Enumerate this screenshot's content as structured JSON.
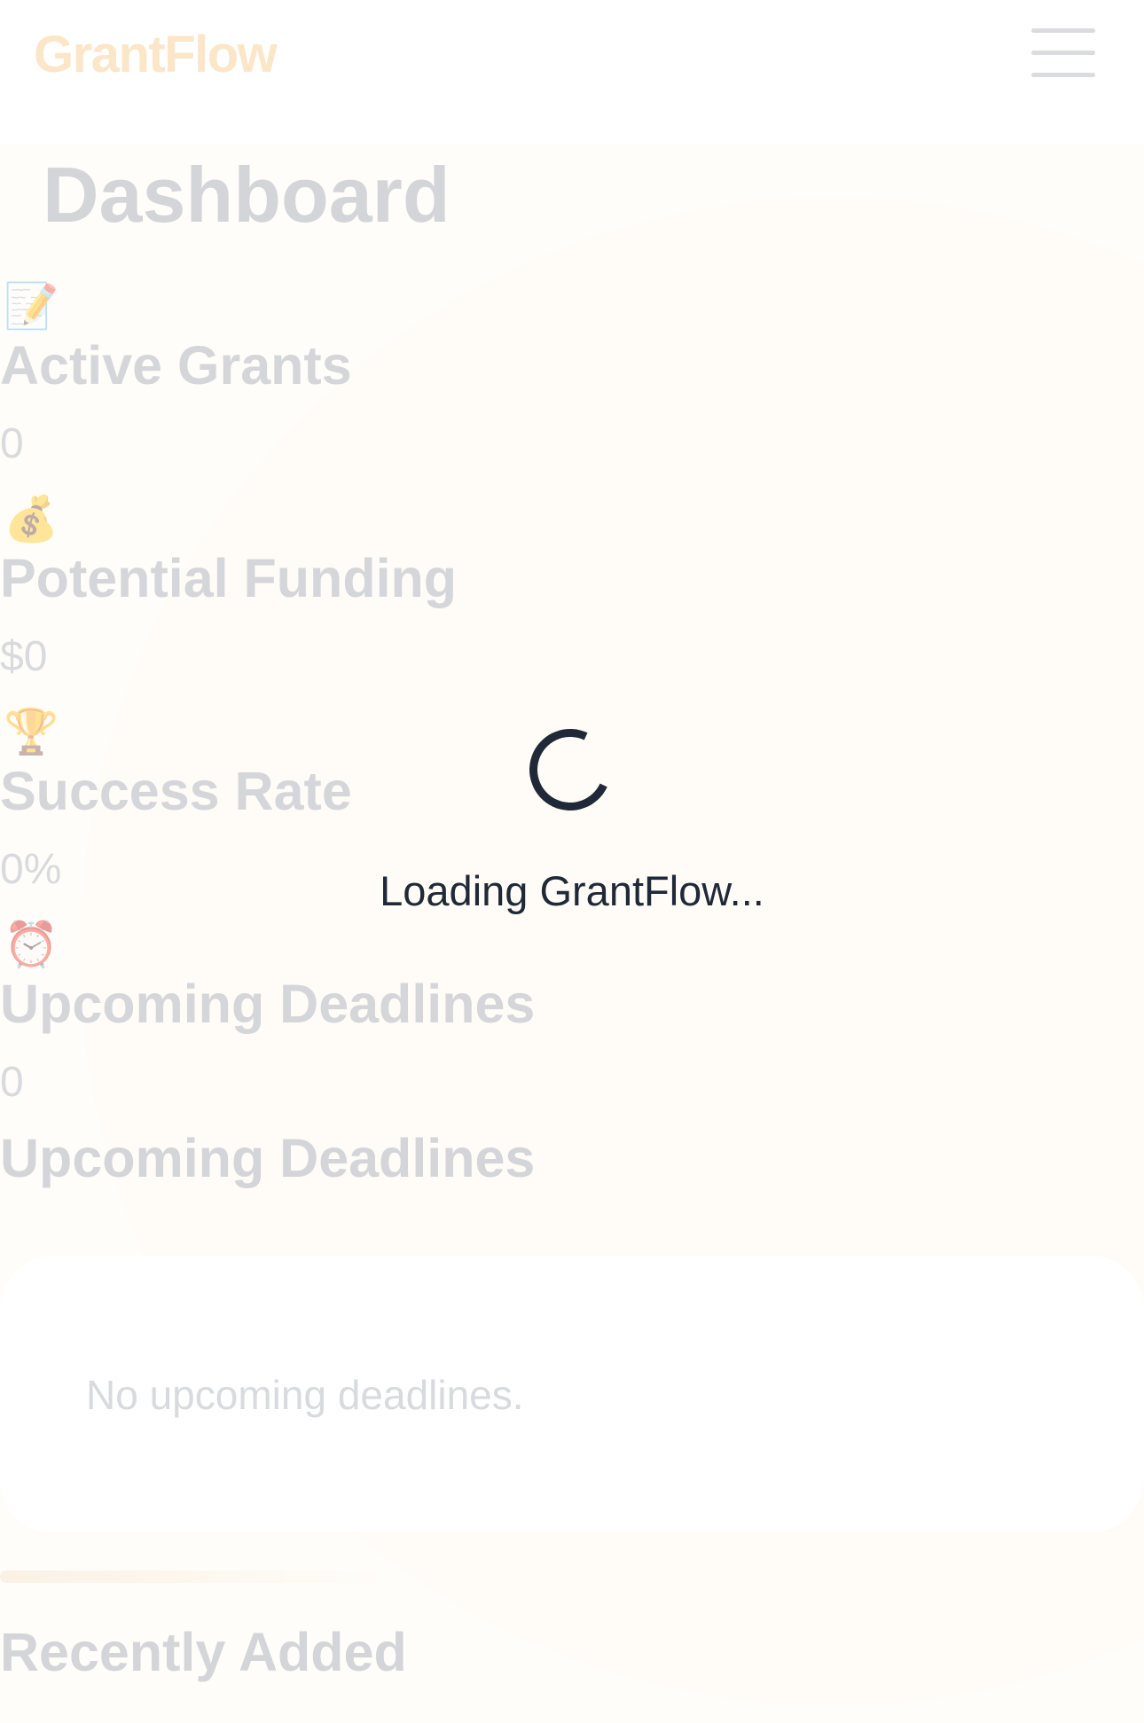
{
  "header": {
    "brand": "GrantFlow",
    "menu_icon": "hamburger-menu-icon"
  },
  "dashboard": {
    "title": "Dashboard",
    "stats": [
      {
        "icon": "memo-icon",
        "glyph": "📝",
        "label": "Active Grants",
        "value": "0"
      },
      {
        "icon": "money-bag-icon",
        "glyph": "💰",
        "label": "Potential Funding",
        "value": "$0"
      },
      {
        "icon": "trophy-icon",
        "glyph": "🏆",
        "label": "Success Rate",
        "value": "0%"
      },
      {
        "icon": "alarm-clock-icon",
        "glyph": "⏰",
        "label": "Upcoming Deadlines",
        "value": "0"
      }
    ],
    "deadlines": {
      "heading": "Upcoming Deadlines",
      "empty_text": "No upcoming deadlines."
    },
    "recent": {
      "heading": "Recently Added"
    }
  },
  "loading": {
    "text": "Loading GrantFlow..."
  },
  "colors": {
    "brand": "#fbe6c8",
    "spinner": "#1f2937",
    "background": "#fffdf9"
  }
}
